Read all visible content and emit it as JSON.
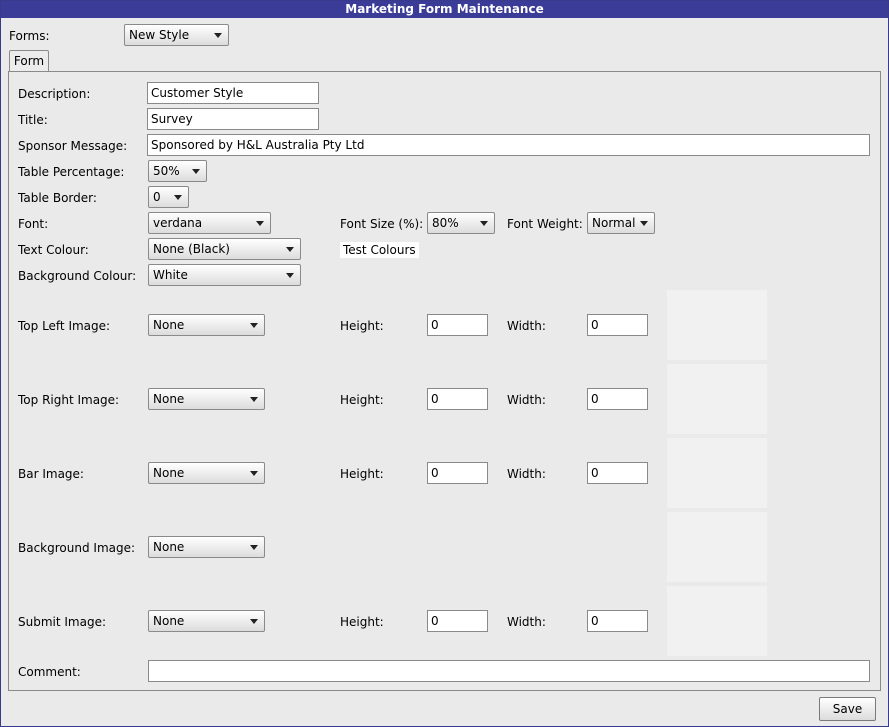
{
  "window": {
    "title": "Marketing Form Maintenance"
  },
  "forms": {
    "label": "Forms:",
    "selected": "New Style"
  },
  "tabs": [
    {
      "label": "Form"
    }
  ],
  "form": {
    "description": {
      "label": "Description:",
      "value": "Customer Style"
    },
    "title": {
      "label": "Title:",
      "value": "Survey"
    },
    "sponsor": {
      "label": "Sponsor Message:",
      "value": "Sponsored by H&L Australia Pty Ltd"
    },
    "table_percentage": {
      "label": "Table Percentage:",
      "value": "50%"
    },
    "table_border": {
      "label": "Table Border:",
      "value": "0"
    },
    "font": {
      "label": "Font:",
      "value": "verdana"
    },
    "font_size": {
      "label": "Font Size (%):",
      "value": "80%"
    },
    "font_weight": {
      "label": "Font Weight:",
      "value": "Normal"
    },
    "text_colour": {
      "label": "Text Colour:",
      "value": "None (Black)"
    },
    "test_colours": "Test Colours",
    "background_colour": {
      "label": "Background Colour:",
      "value": "White"
    },
    "images": [
      {
        "label": "Top Left Image:",
        "value": "None",
        "height_label": "Height:",
        "height": "0",
        "width_label": "Width:",
        "width": "0"
      },
      {
        "label": "Top Right Image:",
        "value": "None",
        "height_label": "Height:",
        "height": "0",
        "width_label": "Width:",
        "width": "0"
      },
      {
        "label": "Bar Image:",
        "value": "None",
        "height_label": "Height:",
        "height": "0",
        "width_label": "Width:",
        "width": "0"
      },
      {
        "label": "Background Image:",
        "value": "None"
      },
      {
        "label": "Submit Image:",
        "value": "None",
        "height_label": "Height:",
        "height": "0",
        "width_label": "Width:",
        "width": "0"
      }
    ],
    "comment": {
      "label": "Comment:",
      "value": ""
    }
  },
  "buttons": {
    "save": "Save"
  }
}
